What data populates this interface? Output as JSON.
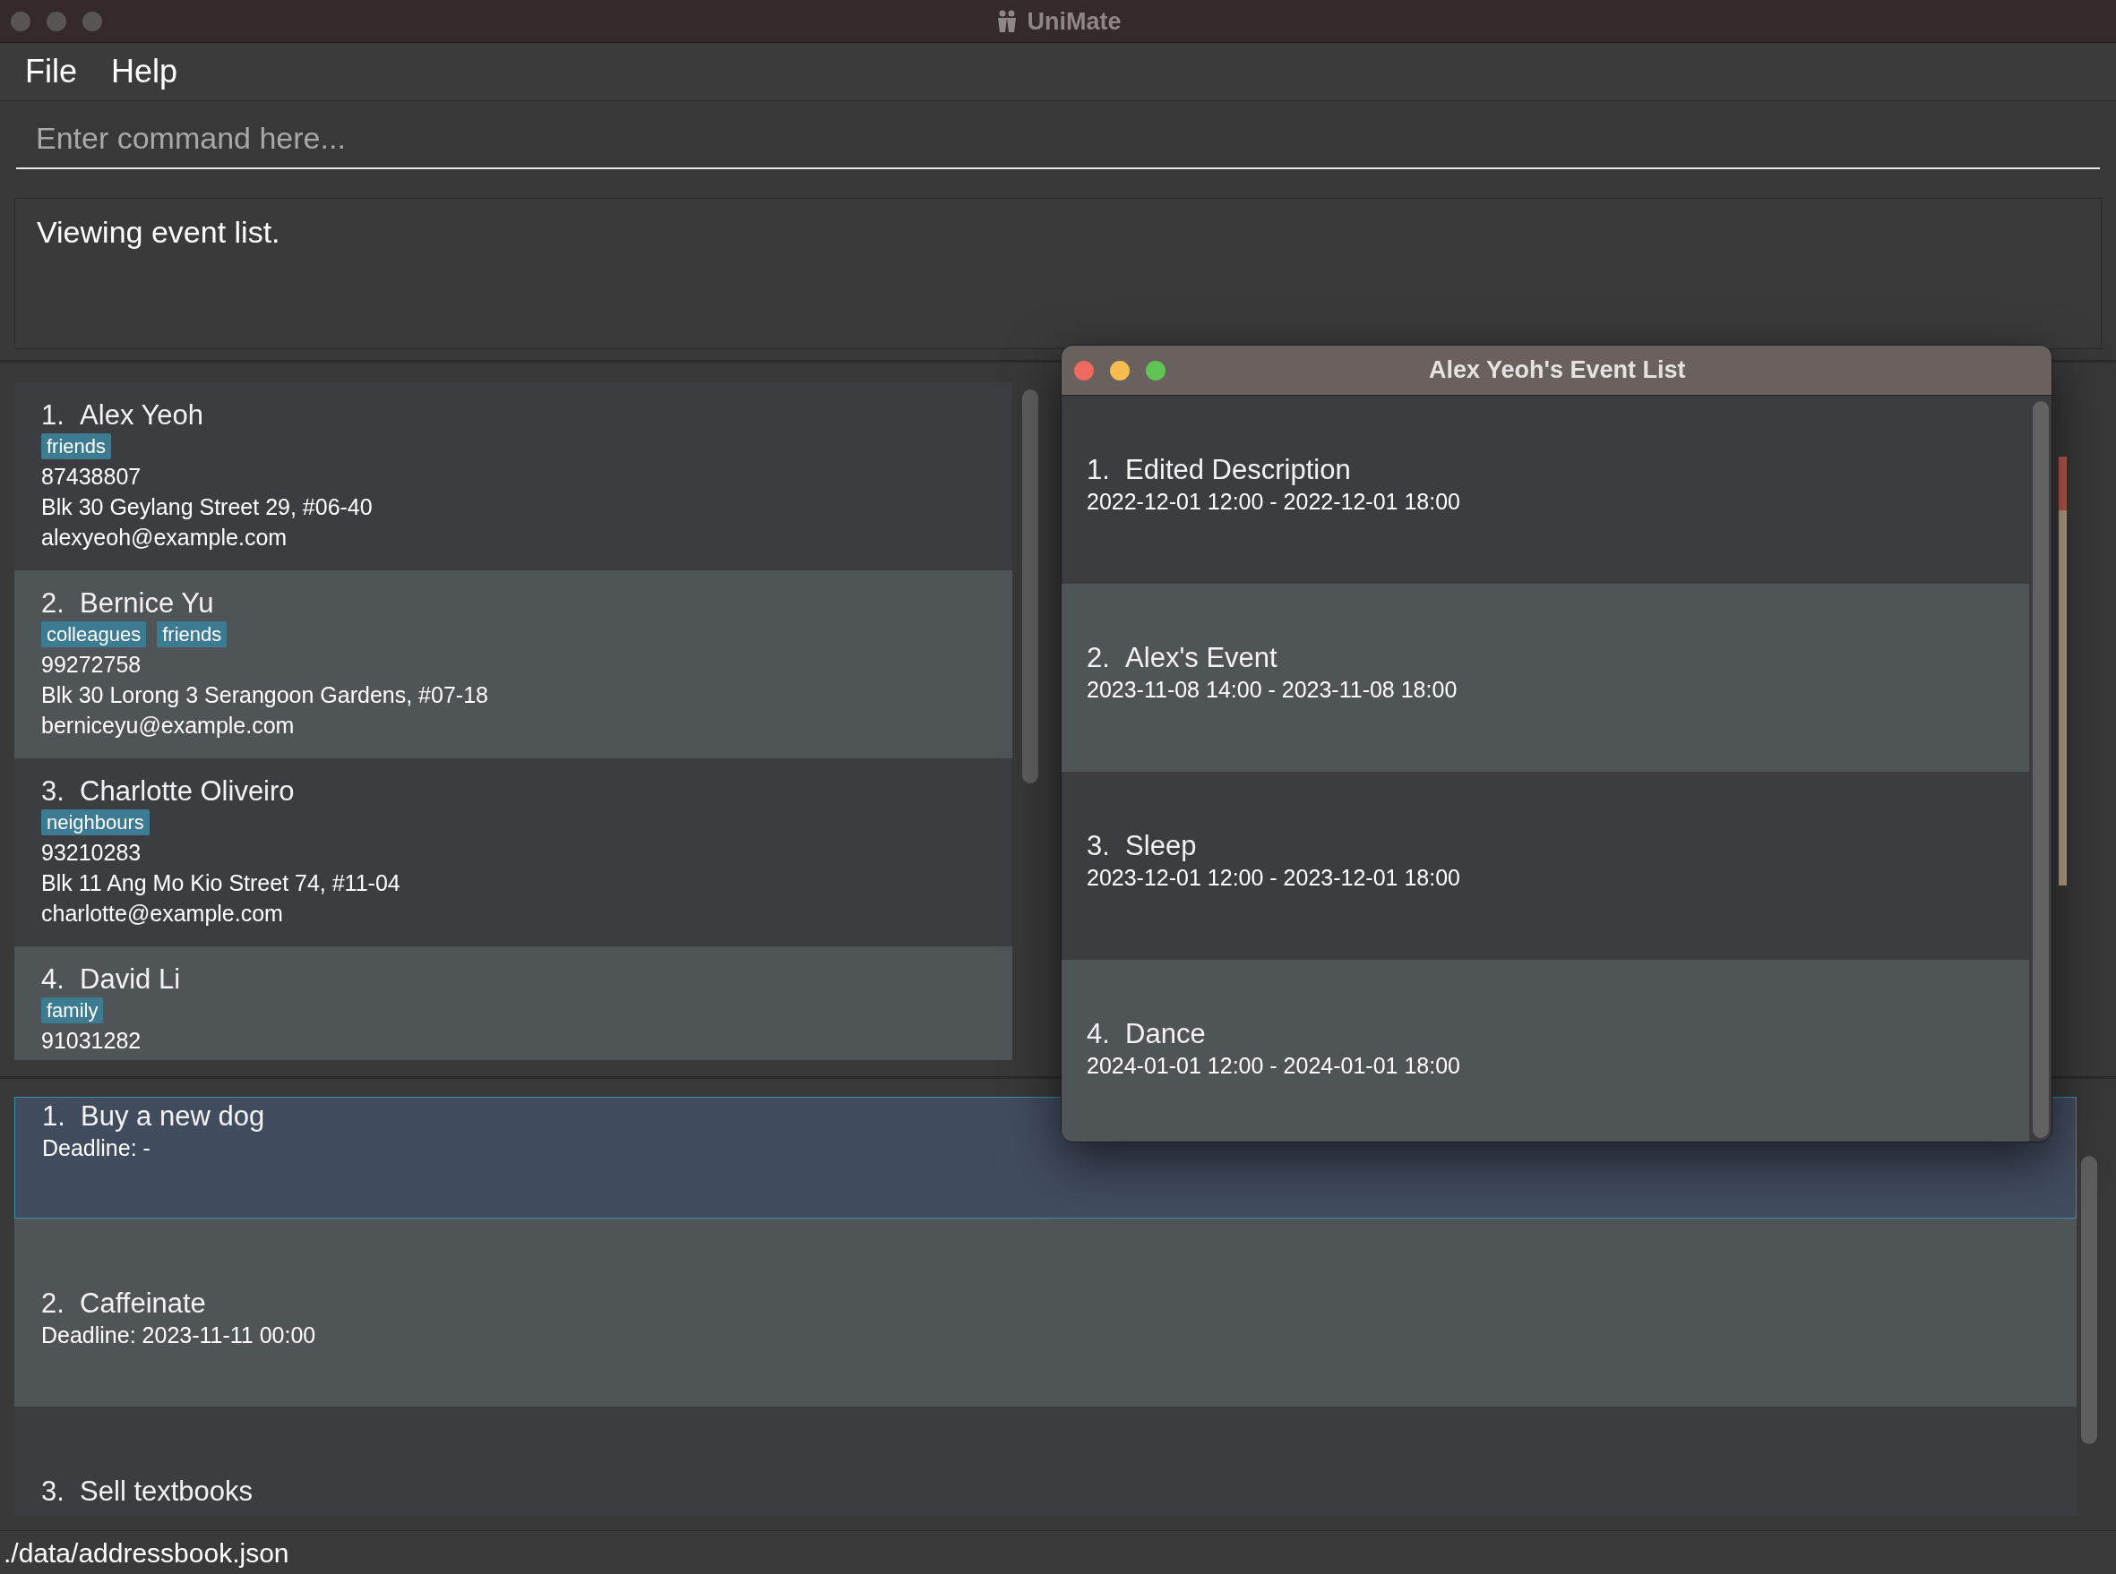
{
  "window": {
    "title": "UniMate"
  },
  "menu": [
    "File",
    "Help"
  ],
  "command": {
    "placeholder": "Enter command here..."
  },
  "result": "Viewing event list.",
  "persons": [
    {
      "index": "1.",
      "name": "Alex Yeoh",
      "tags": [
        "friends"
      ],
      "phone": "87438807",
      "address": "Blk 30 Geylang Street 29, #06-40",
      "email": "alexyeoh@example.com"
    },
    {
      "index": "2.",
      "name": "Bernice Yu",
      "tags": [
        "colleagues",
        "friends"
      ],
      "phone": "99272758",
      "address": "Blk 30 Lorong 3 Serangoon Gardens, #07-18",
      "email": "berniceyu@example.com"
    },
    {
      "index": "3.",
      "name": "Charlotte Oliveiro",
      "tags": [
        "neighbours"
      ],
      "phone": "93210283",
      "address": "Blk 11 Ang Mo Kio Street 74, #11-04",
      "email": "charlotte@example.com"
    },
    {
      "index": "4.",
      "name": "David Li",
      "tags": [
        "family"
      ],
      "phone": "91031282"
    }
  ],
  "tasks": [
    {
      "index": "1.",
      "title": "Buy a new dog",
      "deadline": "Deadline: -",
      "selected": true
    },
    {
      "index": "2.",
      "title": "Caffeinate",
      "deadline": "Deadline: 2023-11-11 00:00",
      "selected": false
    },
    {
      "index": "3.",
      "title": "Sell textbooks",
      "selected": false
    }
  ],
  "status_bar": "./data/addressbook.json",
  "event_window": {
    "title": "Alex Yeoh's Event List",
    "events": [
      {
        "index": "1.",
        "description": "Edited Description",
        "time": "2022-12-01 12:00 - 2022-12-01 18:00"
      },
      {
        "index": "2.",
        "description": "Alex's Event",
        "time": "2023-11-08 14:00 - 2023-11-08 18:00"
      },
      {
        "index": "3.",
        "description": "Sleep",
        "time": "2023-12-01 12:00 - 2023-12-01 18:00"
      },
      {
        "index": "4.",
        "description": "Dance",
        "time": "2024-01-01 12:00 - 2024-01-01 18:00"
      }
    ]
  }
}
